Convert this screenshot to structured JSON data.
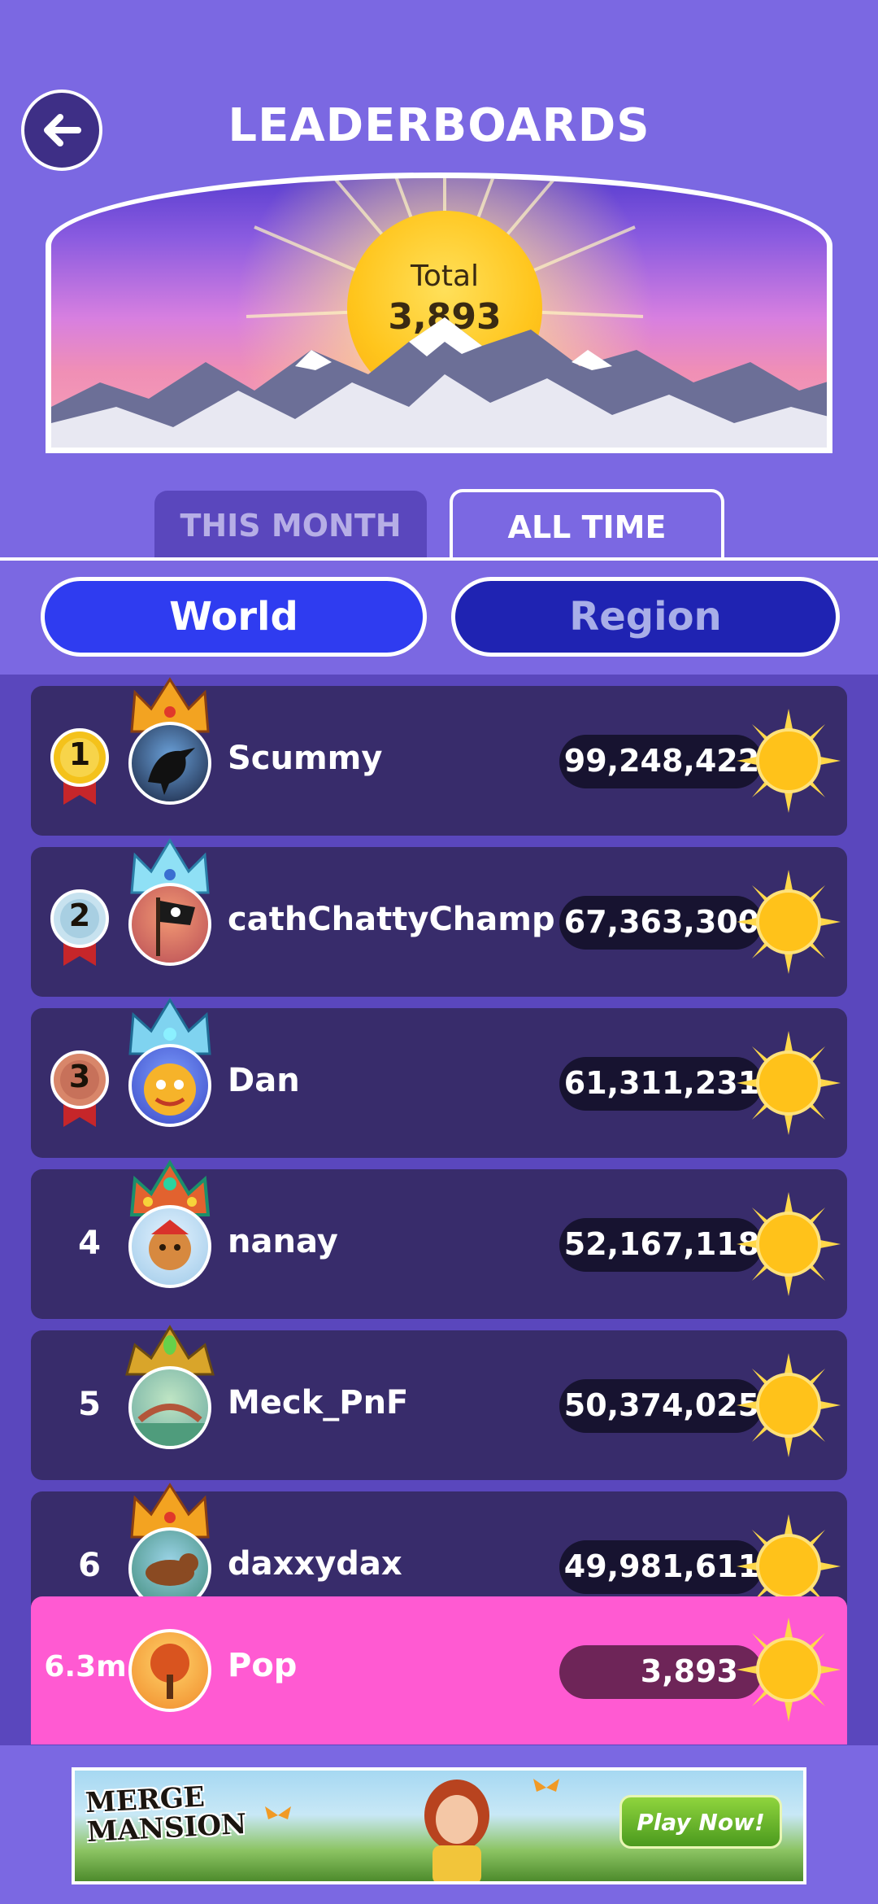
{
  "header": {
    "title": "LEADERBOARDS",
    "total_label": "Total",
    "total_value": "3,893"
  },
  "tabs": [
    {
      "label": "THIS MONTH",
      "active": false
    },
    {
      "label": "ALL TIME",
      "active": true
    }
  ],
  "scope": [
    {
      "label": "World",
      "active": true
    },
    {
      "label": "Region",
      "active": false
    }
  ],
  "leaderboard": [
    {
      "rank": "1",
      "medal": "gold-medal-icon",
      "name": "Scummy",
      "score": "99,248,422",
      "crown": "flame-crown-icon"
    },
    {
      "rank": "2",
      "medal": "silver-medal-icon",
      "name": "cathChattyChamp",
      "score": "67,363,300",
      "crown": "ice-crown-icon"
    },
    {
      "rank": "3",
      "medal": "bronze-medal-icon",
      "name": "Dan",
      "score": "61,311,231",
      "crown": "ice-crown-icon"
    },
    {
      "rank": "4",
      "name": "nanay",
      "score": "52,167,118",
      "crown": "jewel-crown-icon"
    },
    {
      "rank": "5",
      "name": "Meck_PnF",
      "score": "50,374,025",
      "crown": "leaf-crown-icon"
    },
    {
      "rank": "6",
      "name": "daxxydax",
      "score": "49,981,611",
      "crown": "flame-crown-icon"
    }
  ],
  "current_user": {
    "rank": "6.3m",
    "name": "Pop",
    "score": "3,893"
  },
  "ad": {
    "logo_line1": "MERGE",
    "logo_line2": "MANSION",
    "cta": "Play Now!"
  },
  "colors": {
    "background": "#7b68e2",
    "list_background": "#5a47bd",
    "row": "#382c6b",
    "current_user_row": "#ff5ad2",
    "world_button": "#2f3cf0",
    "region_button": "#1f23b2"
  }
}
